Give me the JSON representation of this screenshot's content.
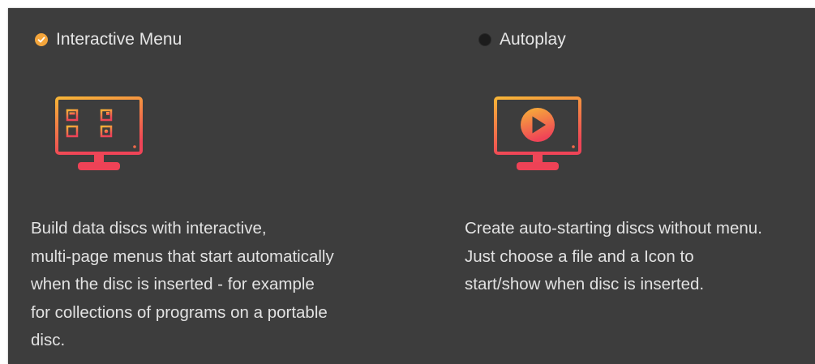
{
  "colors": {
    "panel_bg": "#3d3d3d",
    "accent_orange": "#f4a53b",
    "accent_red": "#ee4256",
    "text": "#e2e2e2"
  },
  "options": {
    "interactive_menu": {
      "label": "Interactive Menu",
      "checked": true,
      "icon": "interactive-menu-monitor-icon",
      "description_lines": [
        "Build data discs with interactive,",
        "multi-page menus that start automatically",
        "when the disc is inserted - for example",
        "for collections of programs on a portable",
        "disc."
      ]
    },
    "autoplay": {
      "label": "Autoplay",
      "checked": false,
      "icon": "autoplay-monitor-icon",
      "description_lines": [
        "Create auto-starting discs without menu.",
        "Just choose a file and a Icon to",
        "start/show when disc is inserted."
      ]
    }
  }
}
